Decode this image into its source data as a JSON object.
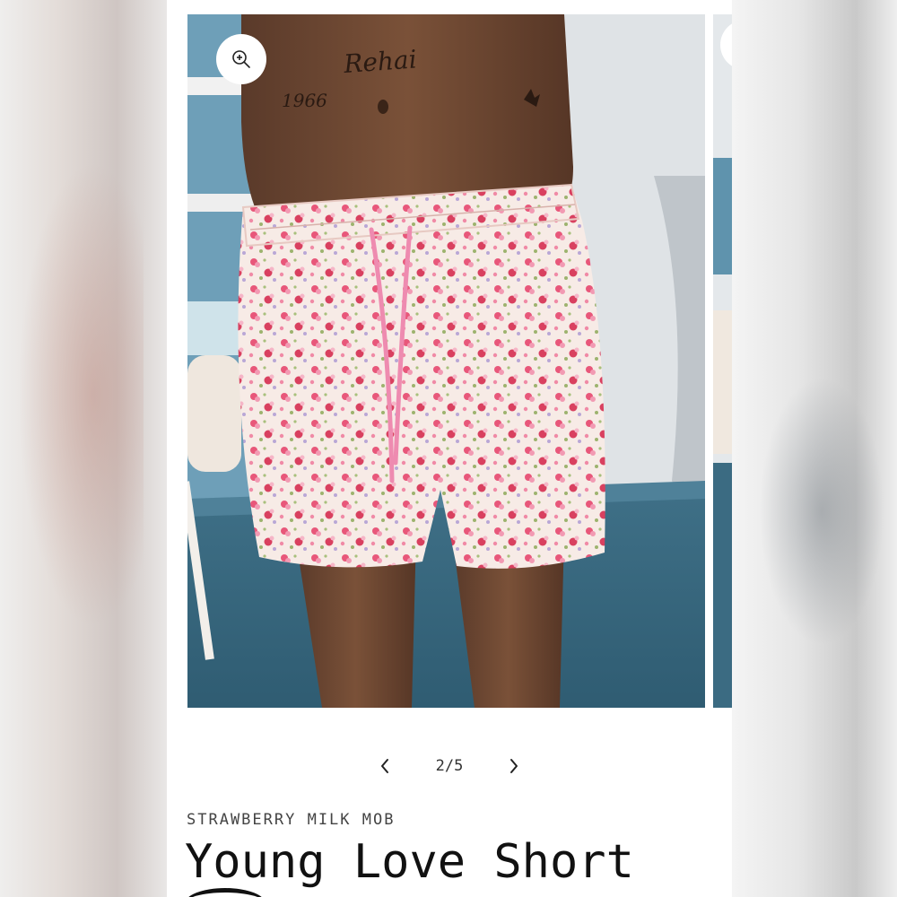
{
  "gallery": {
    "counter": "2/5",
    "zoom_icon": "zoom-in-icon",
    "prev_icon": "chevron-left-icon",
    "next_icon": "chevron-right-icon"
  },
  "product": {
    "vendor": "STRAWBERRY MILK MOB",
    "title": "Young Love Short"
  },
  "colors": {
    "page_background": "#ffffff",
    "text": "#111111",
    "short_base": "#f7ebe6",
    "flower_pink": "#e8577a",
    "drawstring": "#ee8bb0"
  }
}
